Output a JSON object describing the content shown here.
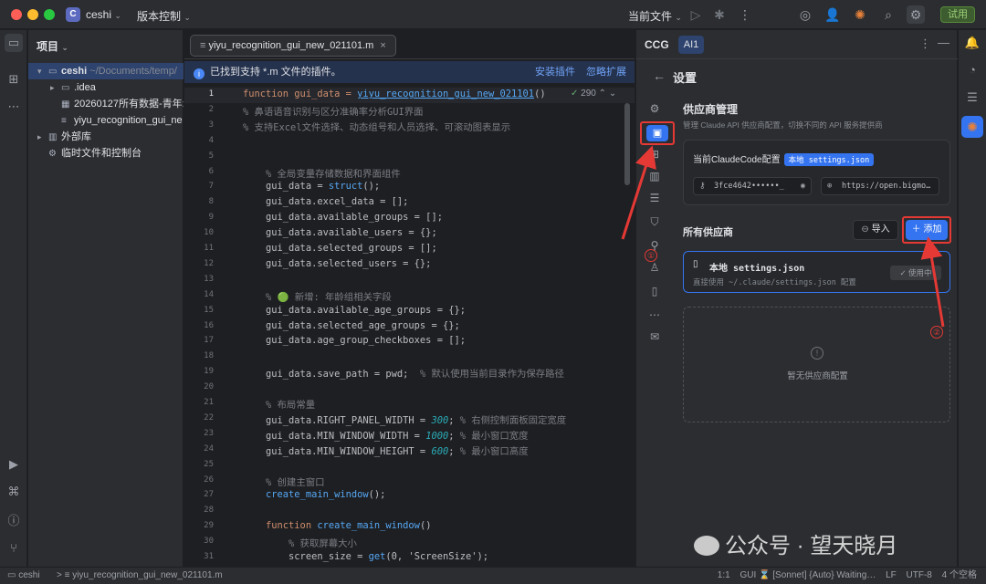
{
  "titlebar": {
    "project_badge": "C",
    "project_name": "ceshi",
    "vcs_label": "版本控制",
    "current_file_label": "当前文件",
    "trial_label": "试用"
  },
  "project_panel": {
    "title": "项目",
    "tree": [
      {
        "name": "ceshi",
        "suffix": "~/Documents/temp/",
        "expanded": true,
        "selected": true
      },
      {
        "name": ".idea",
        "suffix": "",
        "expanded": false
      },
      {
        "name": "20260127所有数据-青年:",
        "suffix": "",
        "expanded": null
      },
      {
        "name": "yiyu_recognition_gui_ne",
        "suffix": "",
        "expanded": null
      },
      {
        "name": "外部库",
        "suffix": "",
        "expanded": false
      },
      {
        "name": "临时文件和控制台",
        "suffix": "",
        "expanded": null
      }
    ]
  },
  "editor": {
    "tab_name": "yiyu_recognition_gui_new_021101.m",
    "banner": {
      "text": "已找到支持 *.m 文件的插件。",
      "install": "安装插件",
      "ignore": "忽略扩展"
    },
    "inspection_count": "290",
    "line_numbers": [
      "1",
      "2",
      "3",
      "4",
      "5",
      "6",
      "7",
      "8",
      "9",
      "10",
      "11",
      "12",
      "13",
      "14",
      "15",
      "16",
      "17",
      "18",
      "19",
      "20",
      "21",
      "22",
      "23",
      "24",
      "25",
      "26",
      "27",
      "28",
      "29",
      "30",
      "31"
    ],
    "lines": [
      {
        "t": "function gui_data = ",
        "c": "kw",
        "rest": "yiyu_recognition_gui_new_021101",
        "rest_c": "link",
        "tail": "()"
      },
      {
        "t": "% 鼻语语音识别与区分准确率分析GUI界面",
        "c": "cm"
      },
      {
        "t": "% 支持Excel文件选择、动态组号和人员选择、可滚动图表显示",
        "c": "cm"
      },
      {
        "t": "",
        "c": ""
      },
      {
        "t": "",
        "c": ""
      },
      {
        "t": "    % 全局变量存储数据和界面组件",
        "c": "cm"
      },
      {
        "t": "    gui_data = ",
        "c": "",
        "rest": "struct",
        "rest_c": "fn",
        "tail": "();"
      },
      {
        "t": "    gui_data.excel_data = [];",
        "c": ""
      },
      {
        "t": "    gui_data.available_groups = [];",
        "c": ""
      },
      {
        "t": "    gui_data.available_users = {};",
        "c": ""
      },
      {
        "t": "    gui_data.selected_groups = [];",
        "c": ""
      },
      {
        "t": "    gui_data.selected_users = {};",
        "c": ""
      },
      {
        "t": "",
        "c": ""
      },
      {
        "t": "    % 🟢 新增: 年龄组相关字段",
        "c": "cm"
      },
      {
        "t": "    gui_data.available_age_groups = {};",
        "c": ""
      },
      {
        "t": "    gui_data.selected_age_groups = {};",
        "c": ""
      },
      {
        "t": "    gui_data.age_group_checkboxes = [];",
        "c": ""
      },
      {
        "t": "",
        "c": ""
      },
      {
        "t": "    gui_data.save_path = pwd;  ",
        "c": "",
        "rest": "% 默认使用当前目录作为保存路径",
        "rest_c": "cm",
        "tail": ""
      },
      {
        "t": "",
        "c": ""
      },
      {
        "t": "    % 布局常量",
        "c": "cm"
      },
      {
        "t": "    gui_data.RIGHT_PANEL_WIDTH = ",
        "c": "",
        "rest": "300",
        "rest_c": "num",
        "tail": "; % 右侧控制面板固定宽度"
      },
      {
        "t": "    gui_data.MIN_WINDOW_WIDTH = ",
        "c": "",
        "rest": "1000",
        "rest_c": "num",
        "tail": "; % 最小窗口宽度"
      },
      {
        "t": "    gui_data.MIN_WINDOW_HEIGHT = ",
        "c": "",
        "rest": "600",
        "rest_c": "num",
        "tail": "; % 最小窗口高度"
      },
      {
        "t": "",
        "c": ""
      },
      {
        "t": "    % 创建主窗口",
        "c": "cm"
      },
      {
        "t": "    ",
        "c": "",
        "rest": "create_main_window",
        "rest_c": "fn",
        "tail": "();"
      },
      {
        "t": "",
        "c": ""
      },
      {
        "t": "    function ",
        "c": "kw",
        "rest": "create_main_window",
        "rest_c": "fn",
        "tail": "()"
      },
      {
        "t": "        % 获取屏幕大小",
        "c": "cm"
      },
      {
        "t": "        screen_size = ",
        "c": "",
        "rest": "get",
        "rest_c": "fn",
        "tail": "(0, 'ScreenSize');"
      }
    ]
  },
  "ccg": {
    "label": "CCG",
    "ai_tab": "AI1",
    "settings_title": "设置",
    "provider_title": "供应商管理",
    "provider_desc": "管理 Claude API 供应商配置，切换不同的 API 服务提供商",
    "current_config_label": "当前ClaudeCode配置",
    "current_config_pill": "本地 settings.json",
    "key_field": "3fce4642••••••_",
    "url_field": "https://open.bigmo…",
    "all_providers": "所有供应商",
    "import_label": "导入",
    "add_label": "添加",
    "provider_card": {
      "name": "本地 settings.json",
      "desc": "直接使用 ~/.claude/settings.json 配置",
      "using": "使用中"
    },
    "empty_text": "暂无供应商配置",
    "annotation_1": "①",
    "annotation_2": "②"
  },
  "statusbar": {
    "project": "ceshi",
    "file": "yiyu_recognition_gui_new_021101.m",
    "position": "1:1",
    "gui_status": "GUI ⌛ [Sonnet] {Auto} Waiting…",
    "line_sep": "LF",
    "encoding": "UTF-8",
    "indent": "4 个空格"
  },
  "watermark": "公众号 · 望天晓月",
  "colors": {
    "accent": "#3574f0",
    "annotation": "#e53935",
    "bg": "#1e1f22",
    "panel": "#2b2d30"
  }
}
